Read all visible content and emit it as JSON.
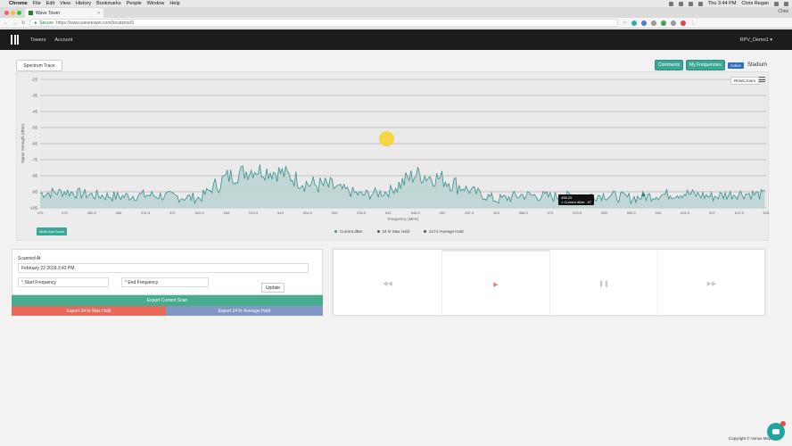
{
  "menubar": {
    "app": "Chrome",
    "items": [
      "File",
      "Edit",
      "View",
      "History",
      "Bookmarks",
      "People",
      "Window",
      "Help"
    ],
    "clock": "Thu 3:44 PM",
    "user": "Chris Regan"
  },
  "browser": {
    "tab_title": "Wave Tower",
    "profile": "Chris",
    "secure_label": "Secure",
    "url": "https://www.wavetower.com/locations/9"
  },
  "nav": {
    "links": [
      "Towers",
      "Account"
    ],
    "user_menu": "RPV_Demo1 ▾"
  },
  "toolbar": {
    "spectrum_trace": "Spectrum Trace",
    "comments": "Comments",
    "my_frequencies": "My Frequencies",
    "active_badge": "Active",
    "location": "Stadium"
  },
  "chart": {
    "reset_zoom": "Reset zoom",
    "multi_scale": "Multi Axis Scale",
    "tooltip_title": "498.25",
    "tooltip_series": "Current dBm",
    "tooltip_value": "-97",
    "legend": [
      {
        "label": "Current dBm",
        "color": "#3a8f8c"
      },
      {
        "label": "24 hr Max Hold",
        "color": "#555555"
      },
      {
        "label": "24 hr Average Hold",
        "color": "#555555"
      }
    ]
  },
  "chart_data": {
    "type": "area",
    "xlabel": "Frequency (MHz)",
    "ylabel": "Signal Strength (dBm)",
    "ylim": [
      -105,
      -25
    ],
    "yticks": [
      "-25",
      "-35",
      "-45",
      "-55",
      "-65",
      "-75",
      "-85",
      "-95",
      "-105"
    ],
    "xticks": [
      "470",
      "475",
      "480.5",
      "486",
      "491.5",
      "497",
      "502.5",
      "508",
      "513.5",
      "519",
      "524.5",
      "530",
      "535.5",
      "541",
      "546.5",
      "552",
      "557.5",
      "563",
      "568.5",
      "574",
      "579.5",
      "585",
      "590.5",
      "596",
      "601.5",
      "607",
      "612.5",
      "618"
    ],
    "grid": true,
    "series": [
      {
        "name": "Current dBm",
        "x": [
          470,
          475,
          480.5,
          486,
          491.5,
          497,
          502.5,
          508,
          513.5,
          519,
          524.5,
          530,
          535.5,
          541,
          546.5,
          552,
          557.5,
          563,
          568.5,
          574,
          579.5,
          585,
          590.5,
          596,
          601.5,
          607,
          612.5,
          618
        ],
        "values": [
          -96,
          -95,
          -97,
          -98,
          -97,
          -98,
          -99,
          -86,
          -81,
          -83,
          -90,
          -92,
          -97,
          -95,
          -84,
          -87,
          -94,
          -100,
          -97,
          -98,
          -98,
          -97,
          -99,
          -97,
          -96,
          -98,
          -96,
          -97
        ]
      }
    ]
  },
  "form": {
    "scanned_at_label": "Scanned At",
    "scanned_at_value": "February 22 2018  3:43 PM",
    "start_freq_placeholder": "Start Frequency",
    "end_freq_placeholder": "End Frequency",
    "required_mark": "*",
    "update": "Update",
    "export_current": "Export Current Scan",
    "export_max": "Export 24 hr Max Hold",
    "export_avg": "Export 24 hr Average Hold"
  },
  "playback": {
    "rewind": "◀◀",
    "play": "▶",
    "pause": "❚❚",
    "forward": "▶▶"
  },
  "footer": {
    "copyright": "Copyright © Vonus Media"
  }
}
